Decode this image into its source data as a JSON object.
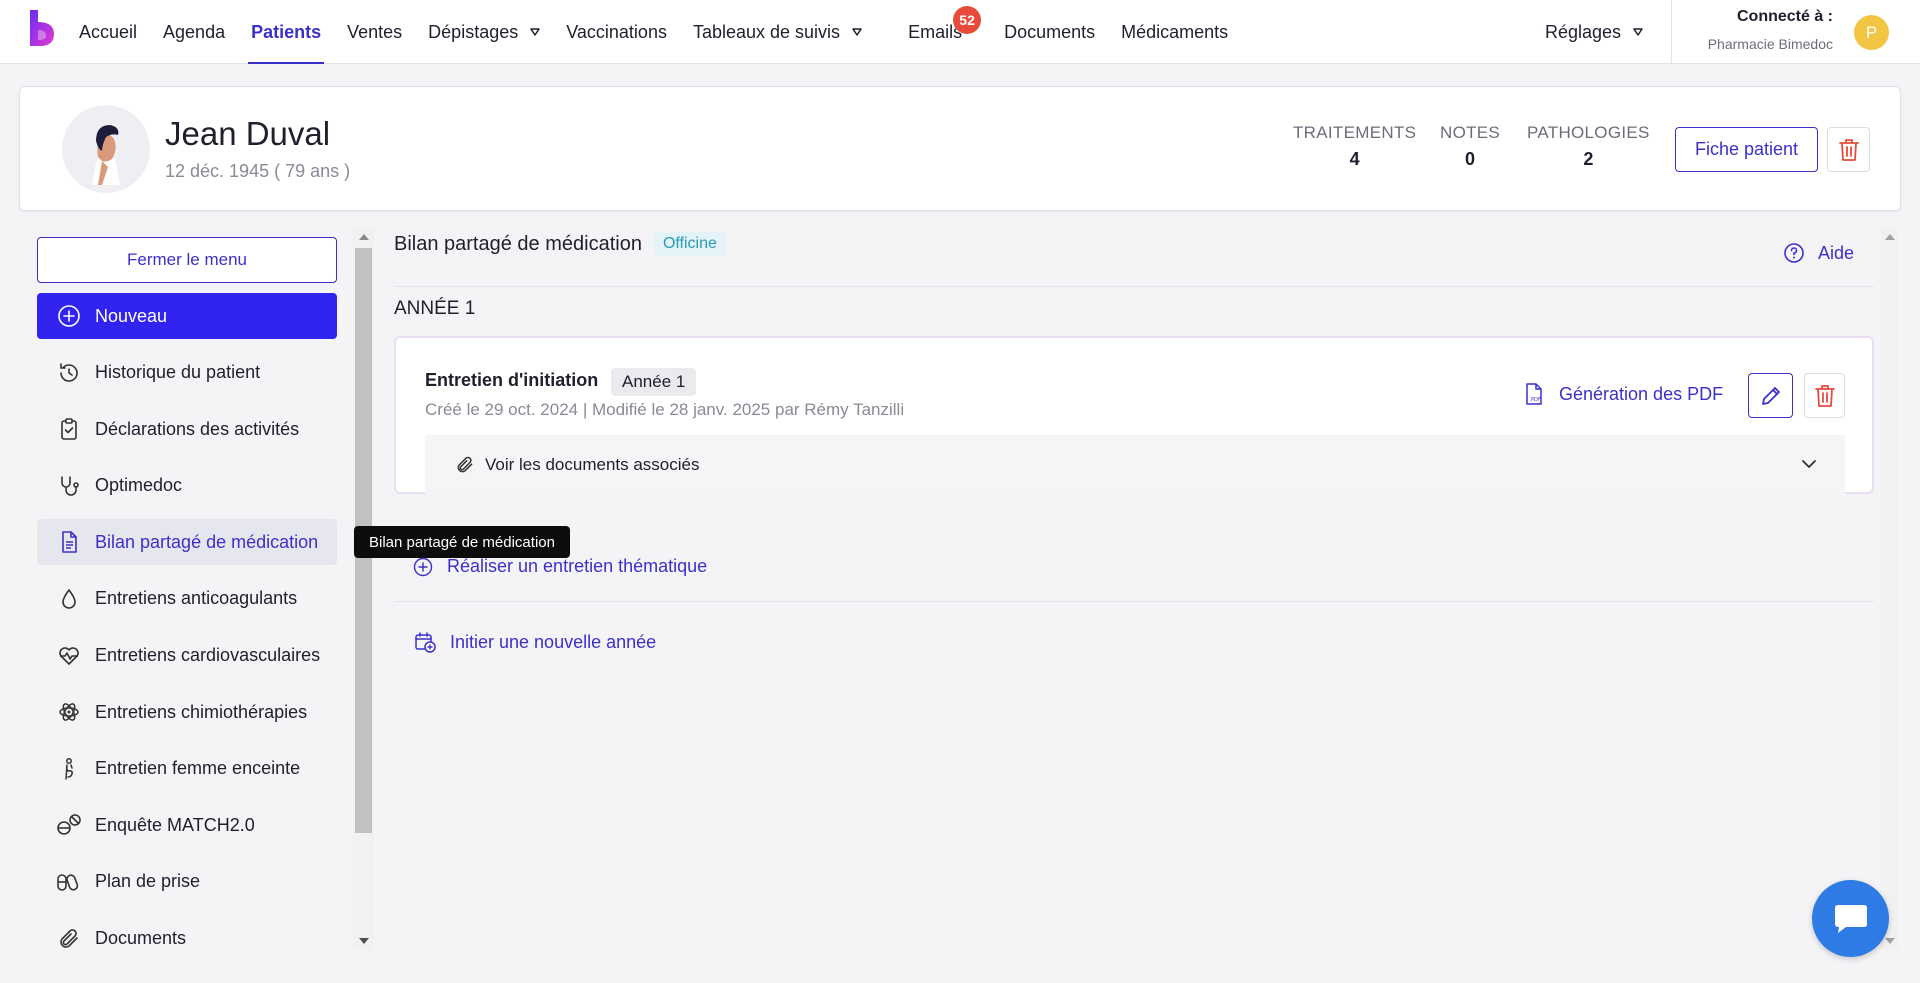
{
  "nav": {
    "items": [
      {
        "label": "Accueil",
        "active": false
      },
      {
        "label": "Agenda",
        "active": false
      },
      {
        "label": "Patients",
        "active": true
      },
      {
        "label": "Ventes",
        "active": false
      },
      {
        "label": "Dépistages",
        "active": false,
        "dropdown": true
      },
      {
        "label": "Vaccinations",
        "active": false
      },
      {
        "label": "Tableaux de suivis",
        "active": false,
        "dropdown": true
      },
      {
        "label": "Emails",
        "active": false,
        "badge": "52"
      },
      {
        "label": "Documents",
        "active": false
      },
      {
        "label": "Médicaments",
        "active": false
      }
    ],
    "settings_label": "Réglages",
    "connected_label": "Connecté à :",
    "pharmacy": "Pharmacie Bimedoc",
    "user_initial": "P",
    "brand_color": "#3b30c9",
    "badge_color": "#e64b3c"
  },
  "patient": {
    "name": "Jean Duval",
    "dob": "12 déc. 1945 ( 79 ans )",
    "stats": [
      {
        "label": "TRAITEMENTS",
        "value": "4"
      },
      {
        "label": "NOTES",
        "value": "0"
      },
      {
        "label": "PATHOLOGIES",
        "value": "2"
      }
    ],
    "profile_button": "Fiche patient"
  },
  "sidebar": {
    "close_label": "Fermer le menu",
    "new_label": "Nouveau",
    "items": [
      {
        "label": "Historique du patient",
        "icon": "history-icon"
      },
      {
        "label": "Déclarations des activités",
        "icon": "clipboard-check-icon"
      },
      {
        "label": "Optimedoc",
        "icon": "stethoscope-icon"
      },
      {
        "label": "Bilan partagé de médication",
        "icon": "document-icon",
        "active": true
      },
      {
        "label": "Entretiens anticoagulants",
        "icon": "drop-icon"
      },
      {
        "label": "Entretiens cardiovasculaires",
        "icon": "heart-pulse-icon"
      },
      {
        "label": "Entretiens chimiothérapies",
        "icon": "atom-icon"
      },
      {
        "label": "Entretien femme enceinte",
        "icon": "pregnant-icon"
      },
      {
        "label": "Enquête MATCH2.0",
        "icon": "pills-icon"
      },
      {
        "label": "Plan de prise",
        "icon": "capsules-icon"
      },
      {
        "label": "Documents",
        "icon": "paperclip-icon"
      }
    ],
    "tooltip": "Bilan partagé de médication"
  },
  "main": {
    "title": "Bilan partagé de médication",
    "tag": "Officine",
    "help_label": "Aide",
    "year_label": "ANNÉE 1",
    "interview": {
      "title": "Entretien d'initiation",
      "tag": "Année 1",
      "meta": "Créé le 29 oct. 2024 | Modifié le 28 janv. 2025 par Rémy Tanzilli",
      "pdf_label": "Génération des PDF",
      "docs_label": "Voir les documents associés"
    },
    "thematic_label": "Réaliser un entretien thématique",
    "new_year_label": "Initier une nouvelle année"
  }
}
